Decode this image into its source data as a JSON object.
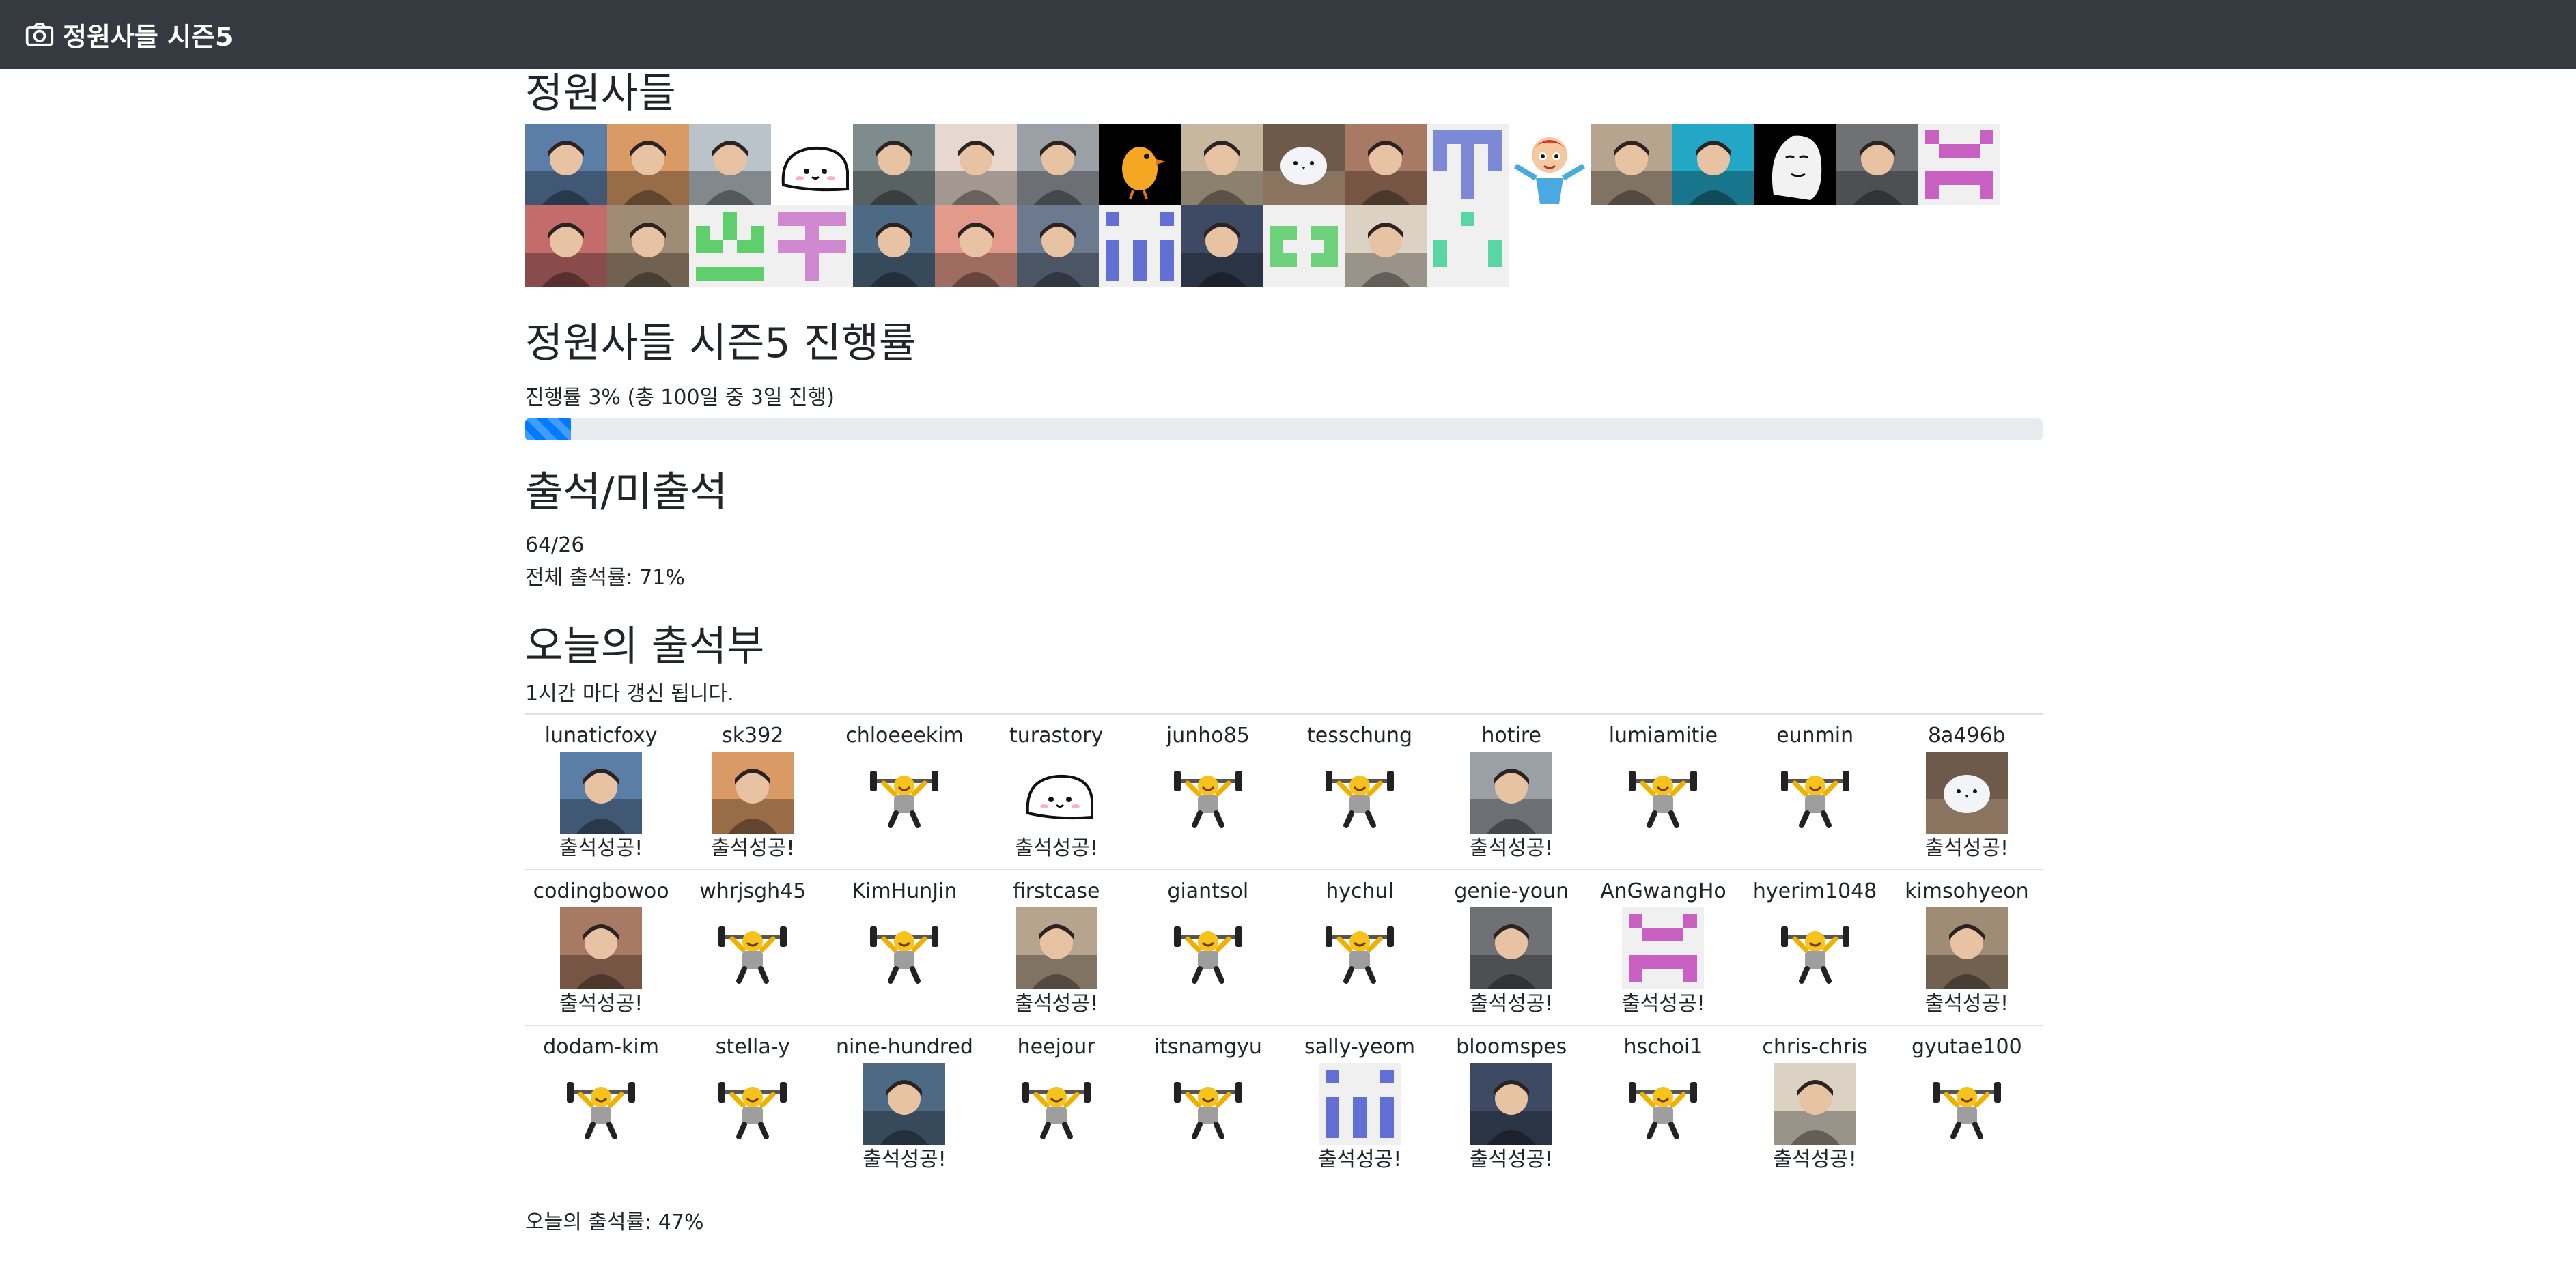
{
  "navbar": {
    "brand": "정원사들 시즌5",
    "icon": "camera-icon"
  },
  "members_heading": "정원사들",
  "member_avatars": [
    {
      "kind": "photo",
      "color": "#5b7ea6"
    },
    {
      "kind": "photo",
      "color": "#d99a66"
    },
    {
      "kind": "photo",
      "color": "#b9c3c9"
    },
    {
      "kind": "seal",
      "color": "#ffffff"
    },
    {
      "kind": "photo",
      "color": "#7f8c8d"
    },
    {
      "kind": "photo",
      "color": "#e7d8cf"
    },
    {
      "kind": "photo",
      "color": "#9aa0a6"
    },
    {
      "kind": "bird",
      "color": "#000000"
    },
    {
      "kind": "photo",
      "color": "#c8b79f"
    },
    {
      "kind": "bird2",
      "color": "#6e5a4a"
    },
    {
      "kind": "photo",
      "color": "#a97a63"
    },
    {
      "kind": "identicon",
      "color": "#7b89d6",
      "pattern": [
        "11111",
        "10101",
        "10101",
        "00100",
        "00100"
      ]
    },
    {
      "kind": "cartoon",
      "color": "#ffffff"
    },
    {
      "kind": "photo",
      "color": "#b7a48e"
    },
    {
      "kind": "photo",
      "color": "#23a7c6"
    },
    {
      "kind": "sketch",
      "color": "#000000"
    },
    {
      "kind": "photo",
      "color": "#6f7175"
    },
    {
      "kind": "identicon",
      "color": "#c961c3",
      "pattern": [
        "10001",
        "01110",
        "00000",
        "11111",
        "10001"
      ]
    },
    {
      "kind": "photo",
      "color": "#c46b6b"
    },
    {
      "kind": "photo",
      "color": "#a08b74"
    },
    {
      "kind": "identicon",
      "color": "#5fcf6d",
      "pattern": [
        "00100",
        "10101",
        "11011",
        "00000",
        "11111"
      ]
    },
    {
      "kind": "identicon",
      "color": "#d088d1",
      "pattern": [
        "11111",
        "00100",
        "11111",
        "00100",
        "00100"
      ]
    },
    {
      "kind": "photo",
      "color": "#4d6a84"
    },
    {
      "kind": "photo",
      "color": "#e39a8b"
    },
    {
      "kind": "photo",
      "color": "#6b7a8f"
    },
    {
      "kind": "identicon",
      "color": "#6270d6",
      "pattern": [
        "10001",
        "00000",
        "10101",
        "10101",
        "10101"
      ]
    },
    {
      "kind": "photo",
      "color": "#3e4a63"
    },
    {
      "kind": "identicon",
      "color": "#6ed17c",
      "pattern": [
        "00000",
        "11011",
        "10001",
        "11011",
        "00000"
      ]
    },
    {
      "kind": "photo",
      "color": "#dcd2c3"
    },
    {
      "kind": "identicon",
      "color": "#58d6a4",
      "pattern": [
        "00100",
        "00000",
        "10001",
        "10001",
        "00000"
      ]
    }
  ],
  "progress": {
    "heading": "정원사들 시즌5 진행률",
    "text": "진행률 3% (총 100일 중 3일 진행)",
    "percent": 3
  },
  "attendance": {
    "heading": "출석/미출석",
    "ratio": "64/26",
    "overall": "전체 출석률: 71%"
  },
  "today": {
    "heading": "오늘의 출석부",
    "note": "1시간 마다 갱신 됩니다.",
    "success_label": "출석성공!",
    "rows": [
      [
        {
          "name": "lunaticfoxy",
          "status": "ok",
          "img": "photo",
          "color": "#5b7ea6"
        },
        {
          "name": "sk392",
          "status": "ok",
          "img": "photo",
          "color": "#d99a66"
        },
        {
          "name": "chloeeekim",
          "status": "no",
          "img": "lifter"
        },
        {
          "name": "turastory",
          "status": "ok",
          "img": "seal",
          "color": "#ffffff"
        },
        {
          "name": "junho85",
          "status": "no",
          "img": "lifter"
        },
        {
          "name": "tesschung",
          "status": "no",
          "img": "lifter"
        },
        {
          "name": "hotire",
          "status": "ok",
          "img": "photo",
          "color": "#9aa0a6"
        },
        {
          "name": "lumiamitie",
          "status": "no",
          "img": "lifter"
        },
        {
          "name": "eunmin",
          "status": "no",
          "img": "lifter"
        },
        {
          "name": "8a496b",
          "status": "ok",
          "img": "bird2",
          "color": "#6e5a4a"
        }
      ],
      [
        {
          "name": "codingbowoo",
          "status": "ok",
          "img": "photo",
          "color": "#a97a63"
        },
        {
          "name": "whrjsgh45",
          "status": "no",
          "img": "lifter"
        },
        {
          "name": "KimHunJin",
          "status": "no",
          "img": "lifter"
        },
        {
          "name": "firstcase",
          "status": "ok",
          "img": "photo",
          "color": "#b7a48e"
        },
        {
          "name": "giantsol",
          "status": "no",
          "img": "lifter"
        },
        {
          "name": "hychul",
          "status": "no",
          "img": "lifter"
        },
        {
          "name": "genie-youn",
          "status": "ok",
          "img": "photo",
          "color": "#6f7175"
        },
        {
          "name": "AnGwangHo",
          "status": "ok",
          "img": "identicon",
          "color": "#c961c3",
          "pattern": [
            "10001",
            "01110",
            "00000",
            "11111",
            "10001"
          ]
        },
        {
          "name": "hyerim1048",
          "status": "no",
          "img": "lifter"
        },
        {
          "name": "kimsohyeon",
          "status": "ok",
          "img": "photo",
          "color": "#a08b74"
        }
      ],
      [
        {
          "name": "dodam-kim",
          "status": "no",
          "img": "lifter"
        },
        {
          "name": "stella-y",
          "status": "no",
          "img": "lifter"
        },
        {
          "name": "nine-hundred",
          "status": "ok",
          "img": "photo",
          "color": "#4d6a84"
        },
        {
          "name": "heejour",
          "status": "no",
          "img": "lifter"
        },
        {
          "name": "itsnamgyu",
          "status": "no",
          "img": "lifter"
        },
        {
          "name": "sally-yeom",
          "status": "ok",
          "img": "identicon",
          "color": "#6270d6",
          "pattern": [
            "10001",
            "00000",
            "10101",
            "10101",
            "10101"
          ]
        },
        {
          "name": "bloomspes",
          "status": "ok",
          "img": "photo",
          "color": "#3e4a63"
        },
        {
          "name": "hschoi1",
          "status": "no",
          "img": "lifter"
        },
        {
          "name": "chris-chris",
          "status": "ok",
          "img": "photo",
          "color": "#dcd2c3"
        },
        {
          "name": "gyutae100",
          "status": "no",
          "img": "lifter"
        }
      ]
    ],
    "rate": "오늘의 출석률: 47%"
  }
}
